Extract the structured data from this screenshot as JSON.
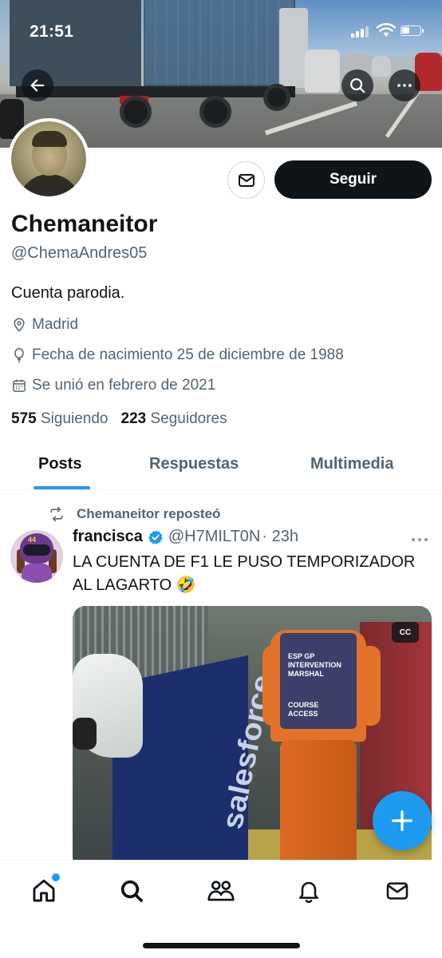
{
  "status_bar": {
    "time": "21:51"
  },
  "header": {
    "back_icon": "arrow-left-icon",
    "search_icon": "search-icon",
    "more_icon": "more-horizontal-icon"
  },
  "profile": {
    "display_name": "Chemaneitor",
    "handle": "@ChemaAndres05",
    "bio": "Cuenta parodia.",
    "location": "Madrid",
    "birthdate": "Fecha de nacimiento 25 de diciembre de 1988",
    "joined": "Se unió en febrero de 2021",
    "following_count": "575",
    "following_label": "Siguiendo",
    "followers_count": "223",
    "followers_label": "Seguidores",
    "follow_button": "Seguir"
  },
  "tabs": [
    {
      "label": "Posts",
      "active": true
    },
    {
      "label": "Respuestas",
      "active": false
    },
    {
      "label": "Multimedia",
      "active": false
    }
  ],
  "tweet": {
    "repost_label": "Chemaneitor reposteó",
    "author_name": "francisca",
    "author_handle": "@H7MILT0N",
    "time": "· 23h",
    "text": "LA CUENTA DE F1 LE PUSO TEMPORIZADOR AL LAGARTO 🤣",
    "media": {
      "caption_badge": "CC",
      "wall_text": "salesforce",
      "vest_lines": [
        "ESP GP",
        "INTERVENTION",
        "MARSHAL",
        "COURSE",
        "ACCESS"
      ]
    }
  },
  "bottom_nav": [
    {
      "icon": "home-icon",
      "active": true,
      "has_badge": true
    },
    {
      "icon": "search-icon",
      "active": false
    },
    {
      "icon": "communities-icon",
      "active": false
    },
    {
      "icon": "bell-icon",
      "active": false
    },
    {
      "icon": "mail-icon",
      "active": false
    }
  ],
  "colors": {
    "accent": "#1d9bf0",
    "text_primary": "#0f1419",
    "text_secondary": "#536471",
    "verified": "#1d9bf0"
  }
}
